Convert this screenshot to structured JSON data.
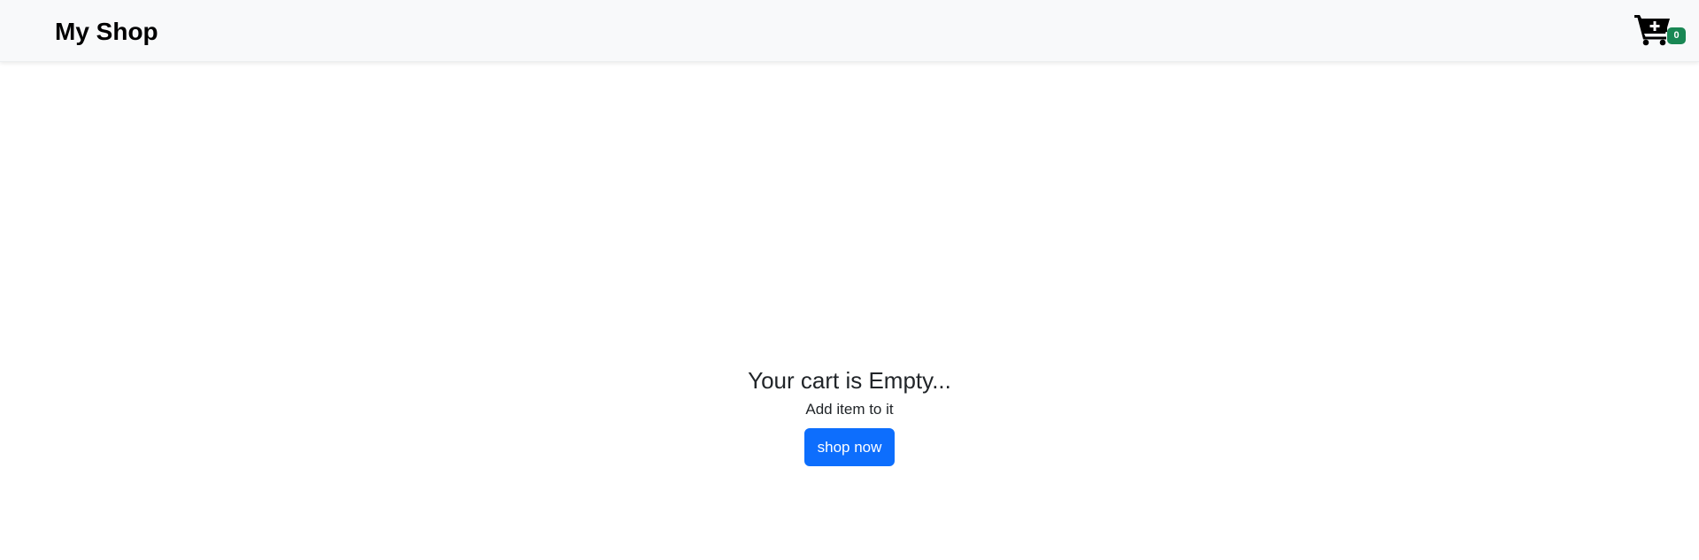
{
  "navbar": {
    "brand": "My Shop",
    "cart": {
      "icon": "cart-plus-icon",
      "count": "0",
      "badge_color": "#198754"
    },
    "background": "#f8f9fa"
  },
  "empty_state": {
    "title": "Your cart is Empty...",
    "subtitle": "Add item to it",
    "button_label": "shop now",
    "button_color": "#0d6efd"
  }
}
